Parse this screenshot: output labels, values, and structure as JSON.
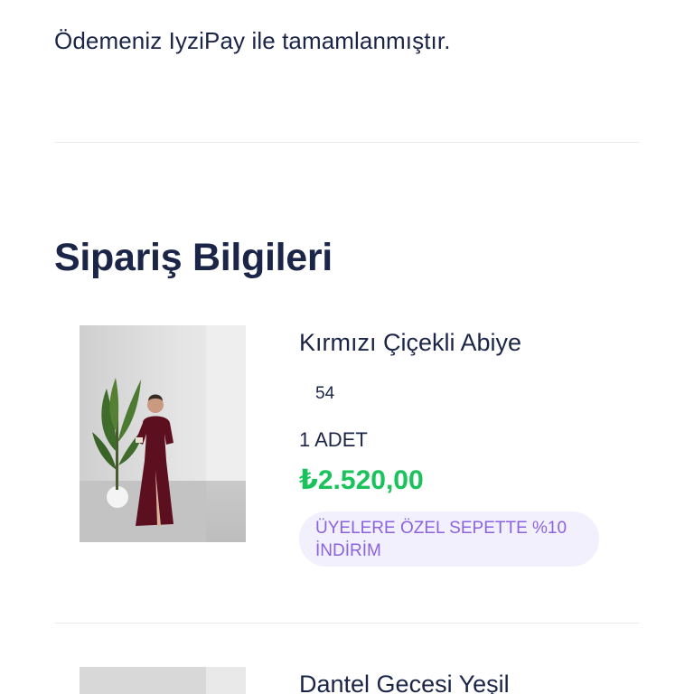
{
  "payment": {
    "message": "Ödemeniz IyziPay ile tamamlanmıştır."
  },
  "order": {
    "title": "Sipariş Bilgileri",
    "items": [
      {
        "name": "Kırmızı Çiçekli Abiye",
        "size": "54",
        "quantity": "1 ADET",
        "price": "₺2.520,00",
        "promo": "ÜYELERE ÖZEL SEPETTE %10 İNDİRİM"
      },
      {
        "name": "Dantel Gecesi Yeşil"
      }
    ]
  },
  "colors": {
    "text": "#1b2547",
    "price": "#19c25a",
    "promo_text": "#8a63e0",
    "promo_bg": "#f3f0fd",
    "divider": "#e9ebef"
  }
}
